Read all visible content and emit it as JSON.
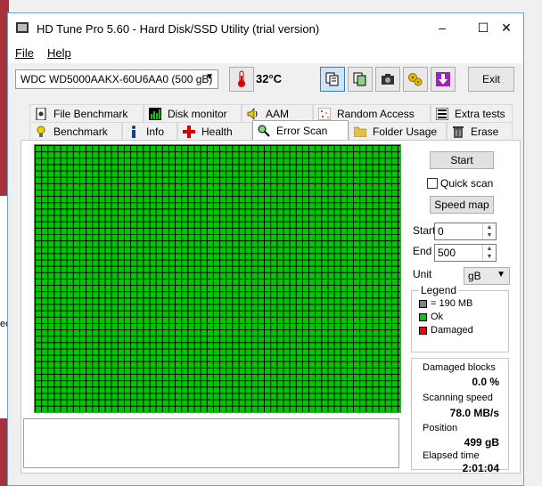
{
  "window": {
    "title": "HD Tune Pro 5.60 - Hard Disk/SSD Utility (trial version)"
  },
  "controls": {
    "minimize": "–",
    "maximize": "☐",
    "close": "✕"
  },
  "menu": [
    {
      "label": "File"
    },
    {
      "label": "Help"
    }
  ],
  "toolbar": {
    "drive": "WDC WD5000AAKX-60U6AA0 (500 gB)",
    "temperature": "32°C",
    "exit": "Exit"
  },
  "tabs_top": [
    {
      "label": "File Benchmark"
    },
    {
      "label": "Disk monitor"
    },
    {
      "label": "AAM"
    },
    {
      "label": "Random Access"
    },
    {
      "label": "Extra tests"
    }
  ],
  "tabs_bottom": [
    {
      "label": "Benchmark"
    },
    {
      "label": "Info"
    },
    {
      "label": "Health"
    },
    {
      "label": "Error Scan"
    },
    {
      "label": "Folder Usage"
    },
    {
      "label": "Erase"
    }
  ],
  "scan": {
    "start_btn": "Start",
    "quick_scan": "Quick scan",
    "speed_map": "Speed map",
    "start_label": "Start",
    "start_value": "0",
    "end_label": "End",
    "end_value": "500",
    "unit_label": "Unit",
    "unit_value": "gB"
  },
  "legend": {
    "title": "Legend",
    "block": "= 190 MB",
    "ok": "Ok",
    "damaged": "Damaged"
  },
  "colors": {
    "ok": "#00c800",
    "damaged": "#ff0000",
    "block": "#808080"
  },
  "stats": {
    "damaged_label": "Damaged blocks",
    "damaged_value": "0.0 %",
    "speed_label": "Scanning speed",
    "speed_value": "78.0 MB/s",
    "position_label": "Position",
    "position_value": "499 gB",
    "elapsed_label": "Elapsed time",
    "elapsed_value": "2:01:04"
  },
  "desktop": {
    "edge_text": "ec"
  }
}
